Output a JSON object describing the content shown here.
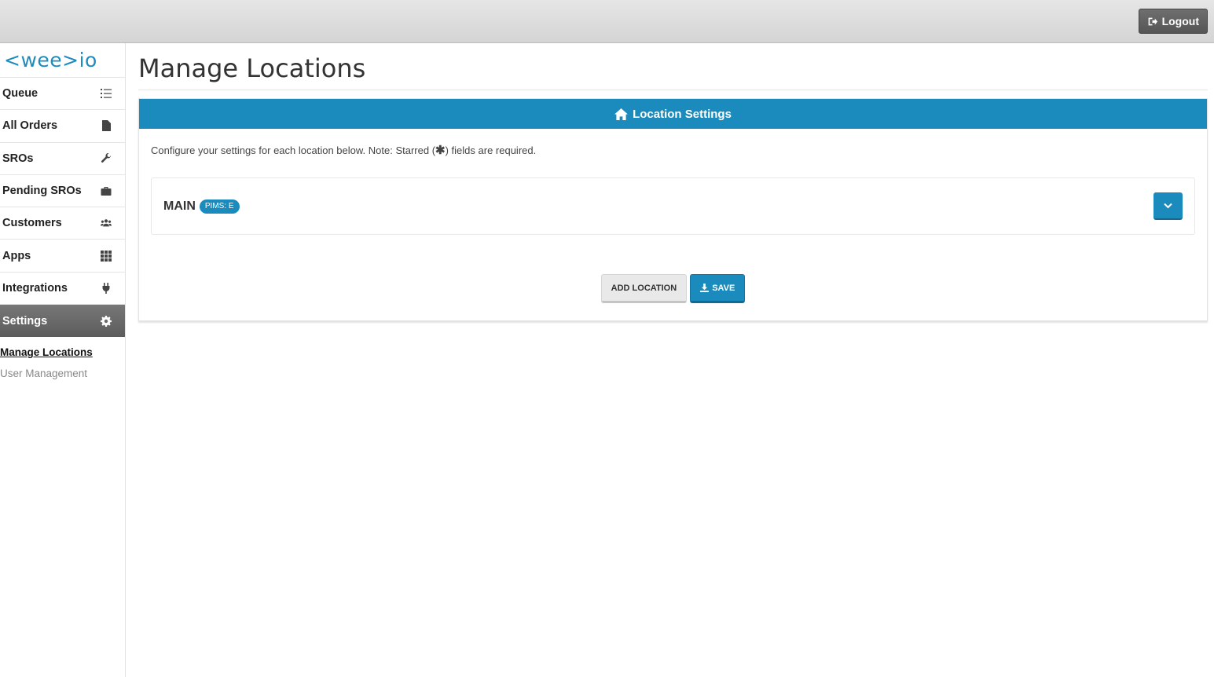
{
  "topbar": {
    "logout_label": "Logout"
  },
  "sidebar": {
    "logo": "<wee>io",
    "items": [
      {
        "label": "Queue",
        "icon": "list-icon"
      },
      {
        "label": "All Orders",
        "icon": "file-icon"
      },
      {
        "label": "SROs",
        "icon": "wrench-icon"
      },
      {
        "label": "Pending SROs",
        "icon": "briefcase-icon"
      },
      {
        "label": "Customers",
        "icon": "users-icon"
      },
      {
        "label": "Apps",
        "icon": "grid-icon"
      },
      {
        "label": "Integrations",
        "icon": "plug-icon"
      },
      {
        "label": "Settings",
        "icon": "gear-icon"
      }
    ],
    "subitems": [
      "Manage Locations",
      "User Management"
    ]
  },
  "main": {
    "title": "Manage Locations",
    "panel": {
      "header": "Location Settings",
      "hint_before": "Configure your settings for each location below. Note: Starred (",
      "hint_star": "✱",
      "hint_after": ") fields are required.",
      "location": {
        "name": "MAIN",
        "badge": "PIMS: E"
      },
      "add_label": "ADD LOCATION",
      "save_label": "SAVE"
    }
  },
  "colors": {
    "accent": "#1b8bbd",
    "active_nav": "#666666"
  }
}
